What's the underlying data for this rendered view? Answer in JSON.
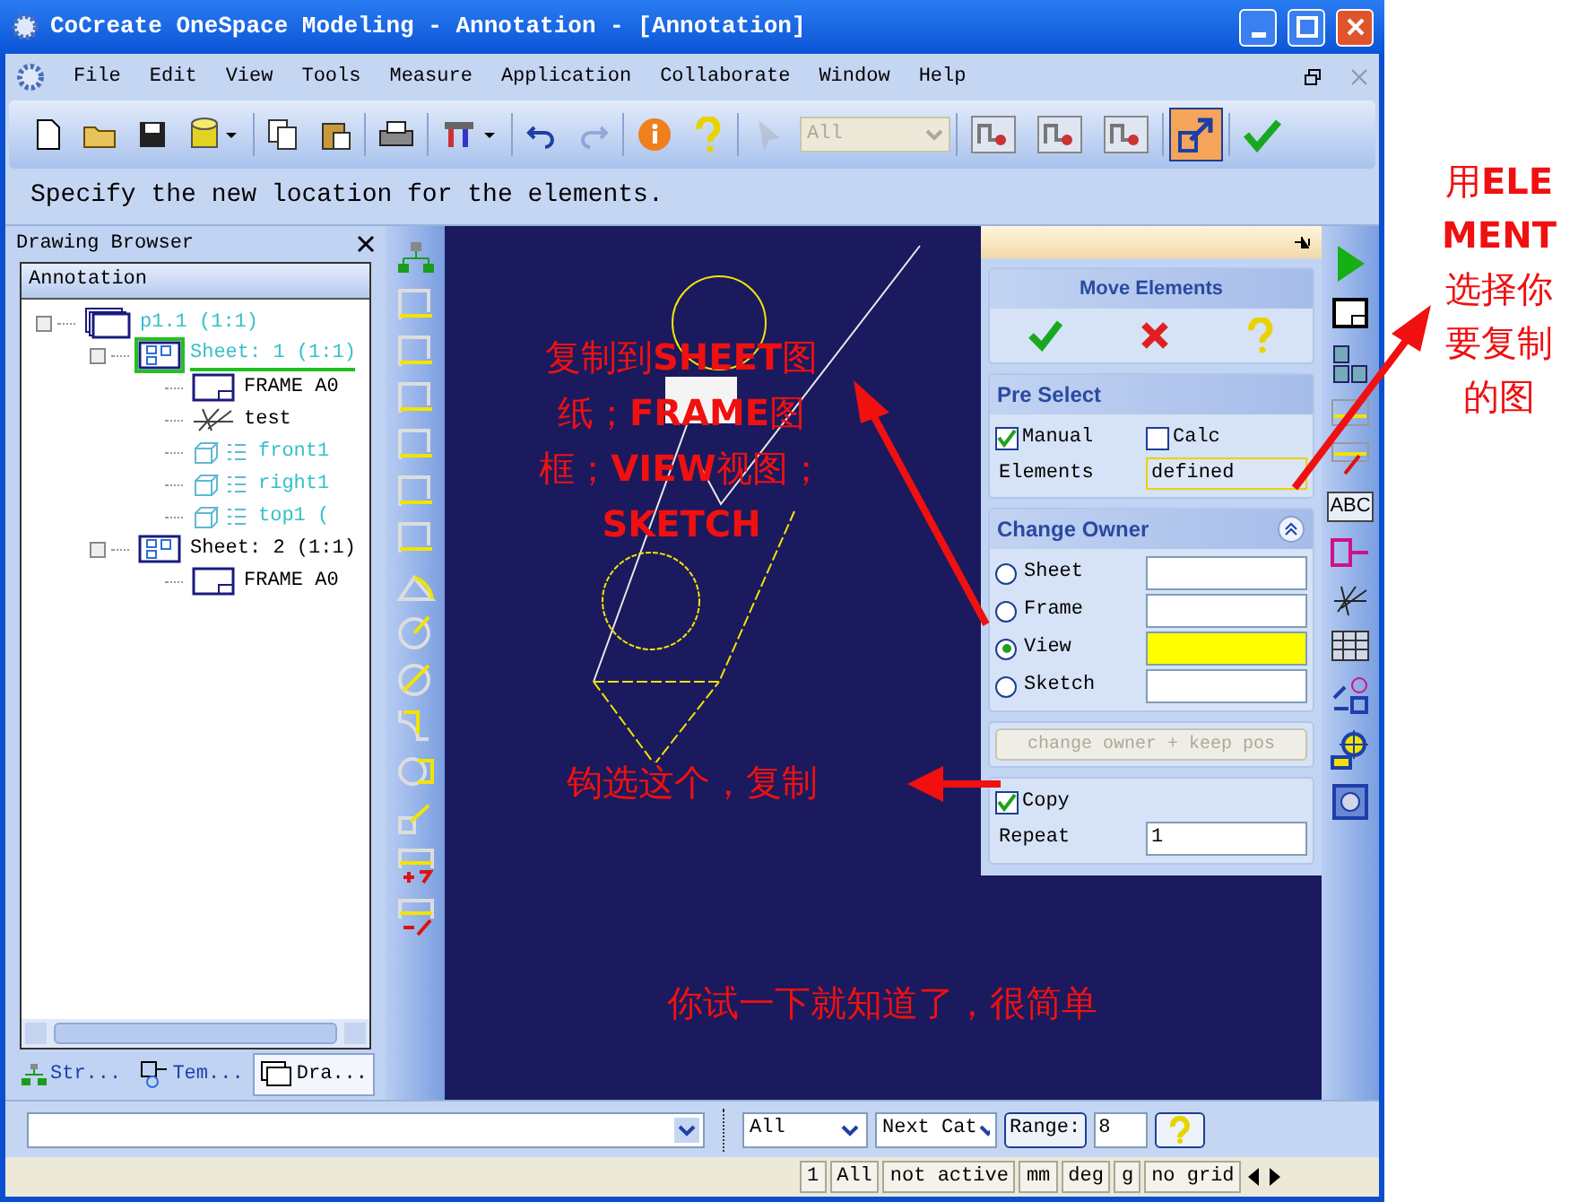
{
  "window": {
    "title": "CoCreate OneSpace Modeling - Annotation - [Annotation]"
  },
  "menu": [
    "File",
    "Edit",
    "View",
    "Tools",
    "Measure",
    "Application",
    "Collaborate",
    "Window",
    "Help"
  ],
  "toolbar": [
    {
      "items": [
        {
          "kind": "new",
          "disabled": false,
          "pressed": false
        },
        {
          "kind": "open",
          "disabled": false,
          "pressed": false
        },
        {
          "kind": "save",
          "disabled": false,
          "pressed": false
        },
        {
          "kind": "database",
          "disabled": false,
          "pressed": false
        }
      ]
    },
    {
      "items": [
        {
          "kind": "copy",
          "disabled": false,
          "pressed": false
        },
        {
          "kind": "paste",
          "disabled": false,
          "pressed": false
        }
      ]
    },
    {
      "items": [
        {
          "kind": "print",
          "disabled": false,
          "pressed": false
        }
      ]
    },
    {
      "items": [
        {
          "kind": "tools",
          "disabled": false,
          "pressed": false
        }
      ]
    },
    {
      "items": [
        {
          "kind": "undo",
          "disabled": false,
          "pressed": false
        },
        {
          "kind": "redo",
          "disabled": true,
          "pressed": false
        }
      ]
    },
    {
      "items": [
        {
          "kind": "info",
          "disabled": false,
          "pressed": false
        },
        {
          "kind": "help",
          "disabled": false,
          "pressed": false
        }
      ]
    },
    {
      "items": [
        {
          "kind": "pointer",
          "disabled": true,
          "pressed": false
        },
        {
          "kind": "select",
          "disabled": true,
          "pressed": false,
          "value": "All"
        }
      ]
    },
    {
      "items": [
        {
          "kind": "filter",
          "disabled": false,
          "pressed": false
        },
        {
          "kind": "filter",
          "disabled": false,
          "pressed": false
        },
        {
          "kind": "filter",
          "disabled": false,
          "pressed": false
        }
      ]
    },
    {
      "items": [
        {
          "kind": "move",
          "disabled": false,
          "pressed": true
        }
      ]
    },
    {
      "items": [
        {
          "kind": "ok",
          "disabled": false,
          "pressed": false
        }
      ]
    }
  ],
  "prompt": "Specify the new location for the elements.",
  "drawing_browser": {
    "title": "Drawing Browser",
    "header": "Annotation",
    "tree": [
      {
        "kind": "part",
        "label": "p1.1 (1:1)",
        "selected": false,
        "children": [
          {
            "kind": "sheet",
            "label": "Sheet: 1 (1:1)",
            "selected": true,
            "children": [
              {
                "kind": "frame",
                "label": "FRAME A0",
                "selected": false
              },
              {
                "kind": "sketch",
                "label": "test",
                "selected": false
              },
              {
                "kind": "view",
                "label": "front1",
                "selected": false
              },
              {
                "kind": "view",
                "label": "right1",
                "selected": false
              },
              {
                "kind": "view",
                "label": "top1 (",
                "selected": false
              }
            ]
          },
          {
            "kind": "sheet",
            "label": "Sheet: 2 (1:1)",
            "selected": false,
            "children": [
              {
                "kind": "frame",
                "label": "FRAME A0",
                "selected": false
              }
            ]
          }
        ]
      }
    ],
    "tabs": [
      {
        "kind": "structure",
        "label": "Str...",
        "selected": false
      },
      {
        "kind": "template",
        "label": "Tem...",
        "selected": false
      },
      {
        "kind": "drawing",
        "label": "Dra...",
        "selected": true
      }
    ]
  },
  "vertical_tools": [
    {
      "kind": "tree"
    },
    {
      "kind": "dim"
    },
    {
      "kind": "dim"
    },
    {
      "kind": "dim"
    },
    {
      "kind": "dim"
    },
    {
      "kind": "dim"
    },
    {
      "kind": "dim"
    },
    {
      "kind": "angle"
    },
    {
      "kind": "radius"
    },
    {
      "kind": "diameter"
    },
    {
      "kind": "chamfer"
    },
    {
      "kind": "hole"
    },
    {
      "kind": "leader"
    },
    {
      "kind": "dim-add"
    },
    {
      "kind": "dim-remove"
    }
  ],
  "move_elements": {
    "title": "Move Elements",
    "pre_select": {
      "title": "Pre Select",
      "manual": {
        "label": "Manual",
        "checked": true
      },
      "calc": {
        "label": "Calc",
        "checked": false
      },
      "elements_label": "Elements",
      "elements_value": "defined"
    },
    "change_owner": {
      "title": "Change Owner",
      "options": [
        {
          "label": "Sheet",
          "selected": false
        },
        {
          "label": "Frame",
          "selected": false
        },
        {
          "label": "View",
          "selected": true
        },
        {
          "label": "Sketch",
          "selected": false
        }
      ]
    },
    "keep_pos_button": {
      "label": "change owner + keep pos",
      "disabled": true
    },
    "copy": {
      "label": "Copy",
      "checked": true
    },
    "repeat_label": "Repeat",
    "repeat_value": "1"
  },
  "right_tools": [
    {
      "kind": "next"
    },
    {
      "kind": "views"
    },
    {
      "kind": "sheets"
    },
    {
      "kind": "dim"
    },
    {
      "kind": "dim-edit"
    },
    {
      "kind": "text",
      "label": "ABC"
    },
    {
      "kind": "label"
    },
    {
      "kind": "sketch"
    },
    {
      "kind": "table"
    },
    {
      "kind": "geometry"
    },
    {
      "kind": "center"
    },
    {
      "kind": "hatch"
    }
  ],
  "command_line": {
    "filter": "All",
    "category": "Next Cat",
    "range_button": "Range:",
    "range_value": "8"
  },
  "status_bar": [
    "1",
    "All",
    "not active",
    "mm",
    "deg",
    "g",
    "no grid"
  ],
  "annotations": [
    {
      "lines": [
        "复制到**SHEET**图",
        "纸；**FRAME**图",
        "框；**VIEW**视图；",
        "**SKETCH**"
      ]
    },
    {
      "lines": [
        "钩选这个，复制"
      ]
    },
    {
      "lines": [
        "你试一下就知道了，很简单"
      ]
    },
    {
      "lines": [
        "用**ELE**",
        "**MENT**",
        "选择你",
        "要复制",
        "的图"
      ]
    }
  ]
}
